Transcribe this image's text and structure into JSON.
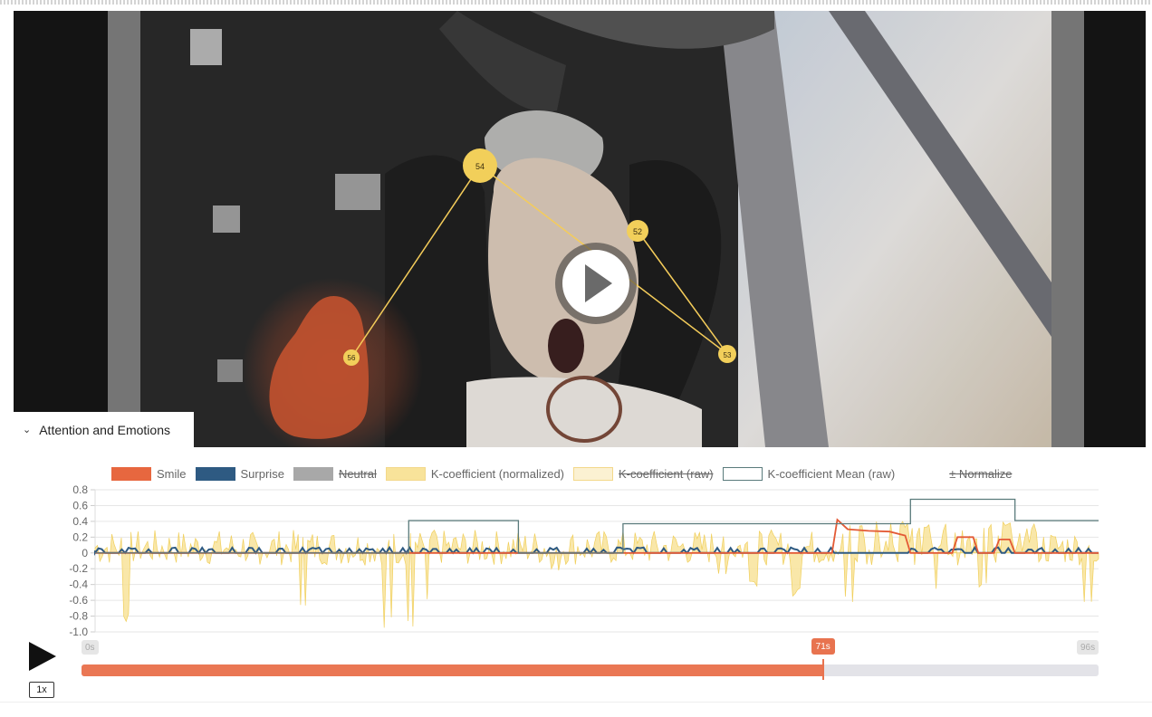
{
  "accordion": {
    "label": "Attention and Emotions"
  },
  "video": {
    "fixations": [
      {
        "label": "54"
      },
      {
        "label": "52"
      },
      {
        "label": "53"
      },
      {
        "label": "56"
      }
    ],
    "heatmap_color": "#c2522f"
  },
  "legend": [
    {
      "label": "Smile",
      "color": "#e7673f",
      "style": "solid",
      "struck": false
    },
    {
      "label": "Surprise",
      "color": "#2e5a82",
      "style": "solid",
      "struck": false
    },
    {
      "label": "Neutral",
      "color": "#a8a8a8",
      "style": "solid",
      "struck": true
    },
    {
      "label": "K-coefficient (normalized)",
      "color": "#f8e39a",
      "style": "solid",
      "struck": false
    },
    {
      "label": "K-coefficient (raw)",
      "color": "#fbf1d2",
      "style": "solid",
      "struck": true
    },
    {
      "label": "K-coefficient Mean (raw)",
      "color": "#5a7b7c",
      "style": "outline",
      "struck": false
    },
    {
      "label": "± Normalize",
      "color": "",
      "style": "none",
      "struck": true
    }
  ],
  "chart_data": {
    "type": "line",
    "y_ticks": [
      "0.8",
      "0.6",
      "0.4",
      "0.2",
      "0",
      "-0.2",
      "-0.4",
      "-0.6",
      "-0.8",
      "-1.0"
    ],
    "ylim": [
      -1.0,
      0.8
    ],
    "xlim": [
      0,
      96
    ],
    "grid": true,
    "legend_position": "top",
    "series": [
      {
        "name": "K-coefficient Mean (raw)",
        "steps": [
          [
            0,
            0
          ],
          [
            30,
            0.41
          ],
          [
            40.5,
            0
          ],
          [
            50.5,
            0.37
          ],
          [
            78,
            0.68
          ],
          [
            88,
            0.41
          ],
          [
            96,
            0.41
          ]
        ]
      },
      {
        "name": "Smile",
        "points": [
          [
            0,
            0
          ],
          [
            70.5,
            0
          ],
          [
            71,
            0.42
          ],
          [
            72,
            0.3
          ],
          [
            74,
            0.28
          ],
          [
            76,
            0.27
          ],
          [
            77.5,
            0.22
          ],
          [
            78,
            0
          ],
          [
            82,
            0
          ],
          [
            82.5,
            0.2
          ],
          [
            84,
            0.2
          ],
          [
            84.5,
            0
          ],
          [
            86,
            0
          ],
          [
            86.5,
            0.17
          ],
          [
            87.5,
            0.17
          ],
          [
            88,
            0
          ],
          [
            96,
            0
          ]
        ]
      }
    ],
    "annotations": [
      {
        "label": "Surprise",
        "note": "near zero with small bumps across the timeline"
      },
      {
        "label": "K-coefficient (normalized)",
        "note": "oscillates between -1.0 and 0.4"
      }
    ]
  },
  "player": {
    "speed": "1x",
    "start_label": "0s",
    "current_label": "71s",
    "end_label": "96s",
    "progress": 0.729
  }
}
